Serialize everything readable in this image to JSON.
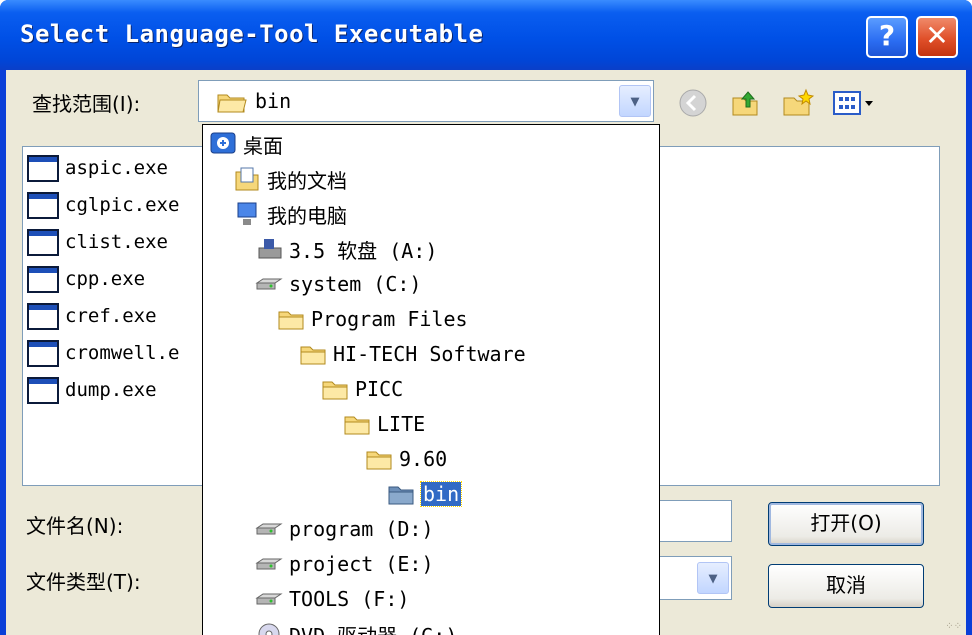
{
  "window": {
    "title": "Select Language-Tool Executable",
    "help_label": "?",
    "close_label": "✕"
  },
  "toolbar": {
    "look_in_label": "查找范围(I):",
    "look_in_value": "bin",
    "icons": [
      "back-icon",
      "up-folder-icon",
      "new-folder-icon",
      "view-menu-icon"
    ]
  },
  "files": [
    {
      "name": "aspic.exe"
    },
    {
      "name": "cglpic.exe"
    },
    {
      "name": "clist.exe"
    },
    {
      "name": "cpp.exe"
    },
    {
      "name": "cref.exe"
    },
    {
      "name": "cromwell.e"
    },
    {
      "name": "dump.exe"
    }
  ],
  "dropdown": {
    "items": [
      {
        "label": "桌面",
        "icon": "desktop-icon"
      },
      {
        "label": "我的文档",
        "icon": "my-documents-icon"
      },
      {
        "label": "我的电脑",
        "icon": "my-computer-icon"
      },
      {
        "label": "3.5 软盘 (A:)",
        "icon": "floppy-drive-icon"
      },
      {
        "label": "system (C:)",
        "icon": "hard-drive-icon"
      },
      {
        "label": "Program Files",
        "icon": "folder-icon"
      },
      {
        "label": "HI-TECH Software",
        "icon": "folder-icon"
      },
      {
        "label": "PICC",
        "icon": "folder-icon"
      },
      {
        "label": "LITE",
        "icon": "folder-icon"
      },
      {
        "label": "9.60",
        "icon": "folder-icon"
      },
      {
        "label": "bin",
        "icon": "open-folder-icon",
        "selected": true
      },
      {
        "label": "program (D:)",
        "icon": "hard-drive-icon"
      },
      {
        "label": "project (E:)",
        "icon": "hard-drive-icon"
      },
      {
        "label": "TOOLS (F:)",
        "icon": "hard-drive-icon"
      },
      {
        "label": "DVD 驱动器 (G:)",
        "icon": "dvd-drive-icon"
      }
    ]
  },
  "bottom": {
    "filename_label": "文件名(N):",
    "filetype_label": "文件类型(T):",
    "open_label": "打开(O)",
    "cancel_label": "取消"
  },
  "colors": {
    "titlebar": "#0054e3",
    "client": "#ece9d8",
    "selection": "#316ac5"
  }
}
